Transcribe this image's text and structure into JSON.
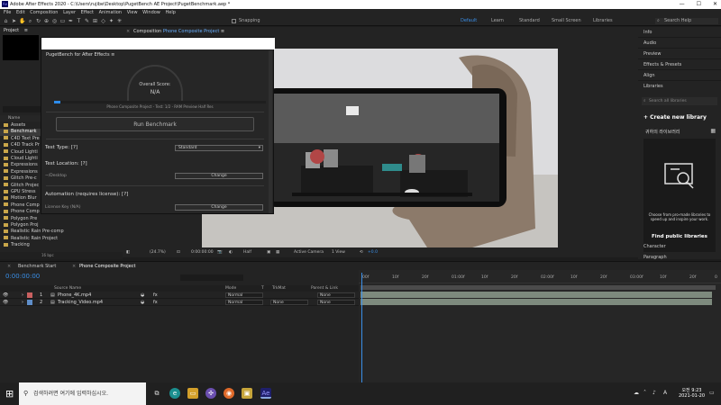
{
  "window": {
    "title": "Adobe After Effects 2020 - C:\\Users\\rujibe\\Desktop\\PugetBench AE Project\\PugetBenchmark.aep *",
    "app_icon_text": "Ae",
    "minimize": "—",
    "maximize": "☐",
    "close": "✕"
  },
  "menu": [
    "File",
    "Edit",
    "Composition",
    "Layer",
    "Effect",
    "Animation",
    "View",
    "Window",
    "Help"
  ],
  "toolbar": {
    "snapping_label": "Snapping",
    "workspaces": [
      "Default",
      "Learn",
      "Standard",
      "Small Screen",
      "Libraries"
    ],
    "active_workspace": "Default",
    "search_help_placeholder": "Search Help"
  },
  "project": {
    "title": "Project",
    "menu_glyph": "≡",
    "column_name": "Name",
    "items": [
      {
        "label": "Assets",
        "selected": false
      },
      {
        "label": "Benchmark",
        "selected": true
      },
      {
        "label": "C4D Text Pre",
        "selected": false
      },
      {
        "label": "C4D Track Pr",
        "selected": false
      },
      {
        "label": "Cloud Lighti",
        "selected": false
      },
      {
        "label": "Cloud Lighti",
        "selected": false
      },
      {
        "label": "Expressions",
        "selected": false
      },
      {
        "label": "Expressions",
        "selected": false
      },
      {
        "label": "Glitch Pre-c",
        "selected": false
      },
      {
        "label": "Glitch Projec",
        "selected": false
      },
      {
        "label": "GPU Stress",
        "selected": false
      },
      {
        "label": "Motion Blur",
        "selected": false
      },
      {
        "label": "Phone Comp",
        "selected": false
      },
      {
        "label": "Phone Comp",
        "selected": false
      },
      {
        "label": "Polygon Pre",
        "selected": false
      },
      {
        "label": "Polygon Proj",
        "selected": false
      },
      {
        "label": "Realistic Rain Pre-comp",
        "selected": false
      },
      {
        "label": "Realistic Rain Project",
        "selected": false
      },
      {
        "label": "Tracking",
        "selected": false
      }
    ],
    "footer_bpc": "16 bpc"
  },
  "plugin": {
    "title": "PugetBench for After Effects",
    "menu_glyph": "≡",
    "overall_score_label": "Overall Score:",
    "overall_score_value": "N/A",
    "progress_fraction": 0.03,
    "current_test": "Phone Composite Project - Test: 1/2 - RAM Preview Half Res",
    "run_button": "Run Benchmark",
    "test_type_label": "Test Type:",
    "test_type_help": "[?]",
    "test_type_value": "Standard",
    "test_location_label": "Test Location:",
    "test_location_help": "[?]",
    "test_location_value": "~/Desktop",
    "change_label": "Change",
    "automation_label": "Automation (requires license):",
    "automation_help": "[?]",
    "license_key_label": "License Key (N/A)",
    "license_change_label": "Change"
  },
  "composition": {
    "prefix": "Composition",
    "name": "Phone Composite Project",
    "menu_glyph": "≡",
    "zoom": "(24.7%)",
    "timecode": "0:00:00:00",
    "resolution": "Half",
    "camera": "Active Camera",
    "views": "1 View",
    "exposure": "+0.0"
  },
  "right_panels": {
    "items": [
      "Info",
      "Audio",
      "Preview",
      "Effects & Presets",
      "Align",
      "Libraries"
    ],
    "library_search_placeholder": "Search all libraries",
    "create_library": "+ Create new library",
    "library_name": "귀하의 라이브러리",
    "promo_text": "Choose from pro-made libraries to speed up and inspire your work.",
    "find_libraries": "Find public libraries",
    "character": "Character",
    "paragraph": "Paragraph"
  },
  "timeline": {
    "tabs": [
      "Benchmark Start",
      "Phone Composite Project"
    ],
    "timecode": "0:00:00:00",
    "columns": [
      "Source Name",
      "Mode",
      "T",
      "TrkMat",
      "Parent & Link"
    ],
    "layers": [
      {
        "num": "1",
        "name": "Phone_4K.mp4",
        "mode": "Normal",
        "trkmat": "",
        "parent": "None"
      },
      {
        "num": "2",
        "name": "Tracking_Video.mp4",
        "mode": "Normal",
        "trkmat": "None",
        "parent": "None"
      }
    ],
    "ruler": [
      "00f",
      "10f",
      "20f",
      "01:00f",
      "10f",
      "20f",
      "02:00f",
      "10f",
      "20f",
      "03:00f",
      "10f",
      "20f"
    ],
    "ruler_end": "0"
  },
  "taskbar": {
    "search_placeholder": "검색하려면 여기에 입력하십시오.",
    "time": "오전 9:23",
    "date": "2021-01-20",
    "lang": "A"
  },
  "colors": {
    "accent": "#2d8ceb",
    "panel_bg": "#232323",
    "folder": "#c9a64a"
  }
}
